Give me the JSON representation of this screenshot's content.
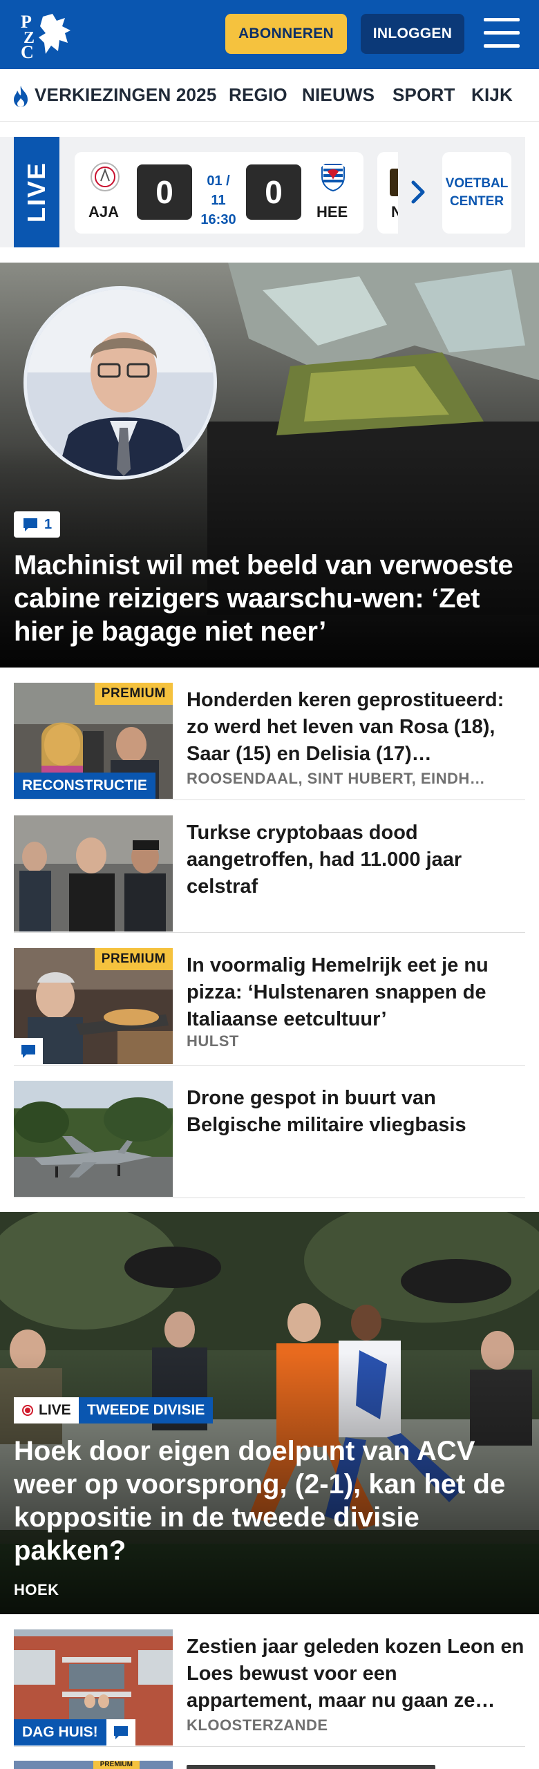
{
  "header": {
    "logo_text": "PZC",
    "subscribe_label": "ABONNEREN",
    "login_label": "INLOGGEN",
    "brand_color": "#0a56b0",
    "accent_color": "#f5c23e"
  },
  "nav": {
    "items": [
      {
        "label": "VERKIEZINGEN 2025",
        "icon": "flame-icon"
      },
      {
        "label": "REGIO"
      },
      {
        "label": "NIEUWS"
      },
      {
        "label": "SPORT"
      },
      {
        "label": "KIJK"
      }
    ]
  },
  "scores": {
    "live_label": "LIVE",
    "match": {
      "home_code": "AJA",
      "home_score": "0",
      "date": "01 / 11",
      "time": "16:30",
      "away_score": "0",
      "away_code": "HEE"
    },
    "next_peek_code": "N",
    "voetbal_center_line1": "VOETBAL",
    "voetbal_center_line2": "CENTER"
  },
  "hero": {
    "comment_count": "1",
    "title": "Machinist wil met beeld van verwoeste cabine reizigers waarschu-wen: ‘Zet hier je bagage niet neer’"
  },
  "articles": [
    {
      "title": "Honderden keren geprostitueerd: zo werd het leven van Rosa (18), Saar (15) en Delisia (17)…",
      "location": "ROOSENDAAL, SINT HUBERT, EINDH…",
      "premium": "PREMIUM",
      "label": "RECONSTRUCTIE"
    },
    {
      "title": "Turkse cryptobaas dood aangetroffen, had 11.000 jaar celstraf"
    },
    {
      "title": "In voormalig Hemelrijk eet je nu pizza: ‘Hulstenaren snappen de Italiaanse eetcultuur’",
      "location": "HULST",
      "premium": "PREMIUM"
    },
    {
      "title": "Drone gespot in buurt van Belgische militaire vliegbasis"
    }
  ],
  "sport_card": {
    "live_label": "LIVE",
    "division_label": "TWEEDE DIVISIE",
    "title": "Hoek door eigen doelpunt van ACV weer op voorsprong, (2-1), kan het de koppositie in de tweede divisie pakken?",
    "location": "HOEK"
  },
  "last_article": {
    "title": "Zestien jaar geleden kozen Leon en Loes bewust voor een appartement, maar nu gaan ze…",
    "location": "KLOOSTERZANDE",
    "label": "DAG HUIS!"
  },
  "peek_article": {
    "premium": "PREMIUM"
  }
}
